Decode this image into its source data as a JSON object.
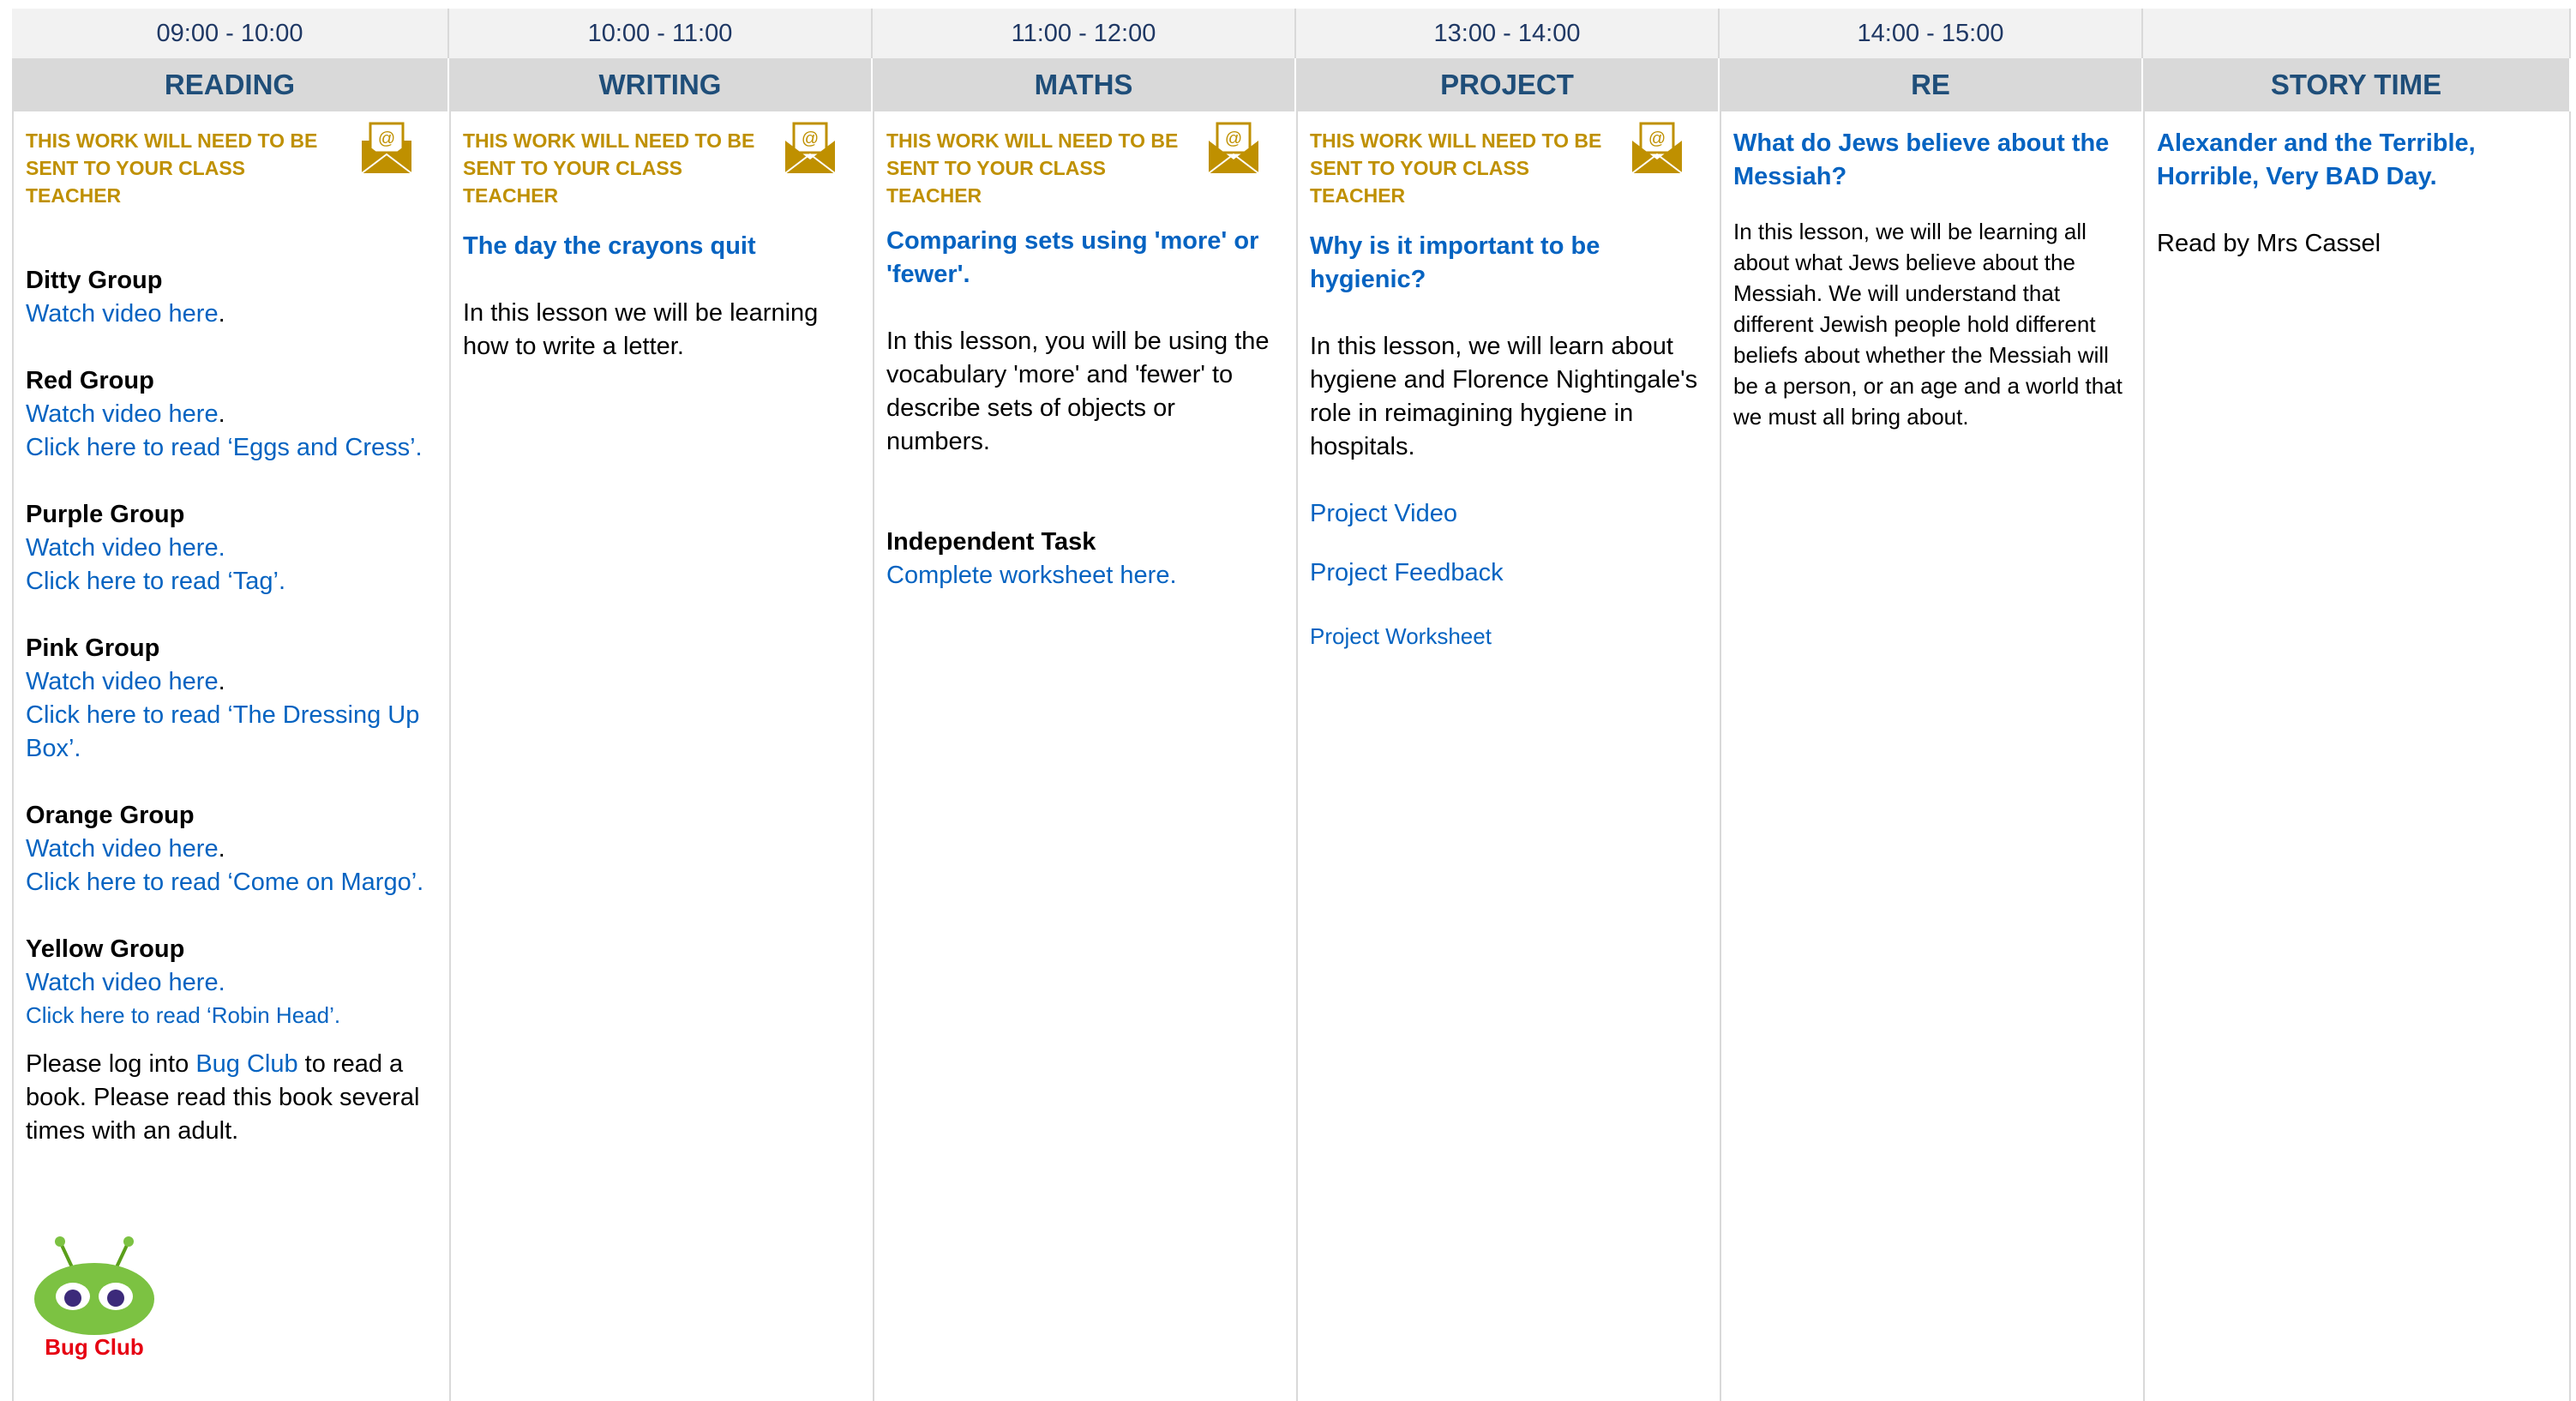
{
  "times": [
    "09:00 - 10:00",
    "10:00 - 11:00",
    "11:00 - 12:00",
    "13:00 - 14:00",
    "14:00 - 15:00",
    ""
  ],
  "subjects": [
    "READING",
    "WRITING",
    "MATHS",
    "PROJECT",
    "RE",
    "STORY TIME"
  ],
  "notice": "THIS WORK WILL NEED TO BE SENT TO YOUR CLASS TEACHER",
  "reading": {
    "groups": [
      {
        "name": "Ditty Group",
        "video": "Watch video here",
        "video_suffix": ".",
        "read": ""
      },
      {
        "name": "Red Group",
        "video": "Watch video here",
        "video_suffix": ".",
        "read": "Click here to read ‘Eggs and Cress’."
      },
      {
        "name": "Purple Group",
        "video": "Watch video here.",
        "video_suffix": "",
        "read": "Click here to read ‘Tag’."
      },
      {
        "name": "Pink Group",
        "video": "Watch video here",
        "video_suffix": ".",
        "read": "Click here to read ‘The Dressing Up Box’."
      },
      {
        "name": "Orange Group",
        "video": "Watch video here",
        "video_suffix": ".",
        "read": "Click here to read ‘Come on Margo’."
      },
      {
        "name": "Yellow Group",
        "video": "Watch video here.",
        "video_suffix": "",
        "read": "Click here to read ‘Robin Head’."
      }
    ],
    "bug_pre": "Please log into ",
    "bug_link": "Bug Club",
    "bug_post": " to read a book. Please read this book several times with an adult.",
    "logo_text": "Bug Club"
  },
  "writing": {
    "title": "The day the crayons quit",
    "body": "In this lesson we will be learning how to write a letter."
  },
  "maths": {
    "title": "Comparing sets using 'more' or 'fewer'.",
    "body": "In this lesson, you will be using the vocabulary 'more' and 'fewer' to describe sets of objects or numbers.",
    "task_label": "Independent Task",
    "task_link": "Complete worksheet here."
  },
  "project": {
    "title": "Why is it important to be hygienic?",
    "body": "In this lesson, we will learn about hygiene and Florence Nightingale's role in reimagining hygiene in hospitals.",
    "links": [
      "Project Video",
      "Project Feedback",
      "Project Worksheet"
    ]
  },
  "re": {
    "title": "What do Jews believe about the Messiah?",
    "body": "In this lesson, we will be learning all about what Jews believe about the Messiah. We will understand that different Jewish people hold different beliefs about whether the Messiah will be a person, or an age and a world that we must all bring about."
  },
  "story": {
    "title": "Alexander and the Terrible, Horrible, Very BAD Day.",
    "body": "Read by Mrs Cassel"
  },
  "colors": {
    "accent": "#0563c1",
    "notice": "#bf9000",
    "header": "#1f4e79"
  }
}
